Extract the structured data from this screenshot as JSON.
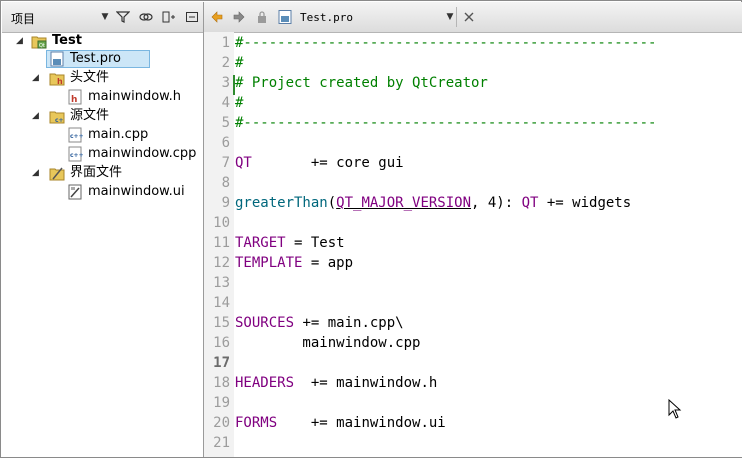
{
  "left_pane": {
    "title": "项目",
    "tree": [
      {
        "label": "Test",
        "level": 0,
        "icon": "qt-project-icon",
        "bold": true
      },
      {
        "label": "Test.pro",
        "level": 1,
        "icon": "pro-file-icon",
        "selected": true
      },
      {
        "label": "头文件",
        "level": 1,
        "icon": "header-folder-icon"
      },
      {
        "label": "mainwindow.h",
        "level": 2,
        "icon": "header-file-icon"
      },
      {
        "label": "源文件",
        "level": 1,
        "icon": "source-folder-icon"
      },
      {
        "label": "main.cpp",
        "level": 2,
        "icon": "cpp-file-icon"
      },
      {
        "label": "mainwindow.cpp",
        "level": 2,
        "icon": "cpp-file-icon"
      },
      {
        "label": "界面文件",
        "level": 1,
        "icon": "form-folder-icon"
      },
      {
        "label": "mainwindow.ui",
        "level": 2,
        "icon": "ui-file-icon"
      }
    ]
  },
  "editor": {
    "file_name": "Test.pro",
    "line_numbers": [
      "1",
      "2",
      "3",
      "4",
      "5",
      "6",
      "7",
      "8",
      "9",
      "10",
      "11",
      "12",
      "13",
      "14",
      "15",
      "16",
      "17",
      "18",
      "19",
      "20",
      "21"
    ],
    "current_line": "17",
    "lines": [
      "#-------------------------------------------------",
      "#",
      "# Project created by QtCreator",
      "#",
      "#-------------------------------------------------",
      "",
      "QT       += core gui",
      "",
      "greaterThan(QT_MAJOR_VERSION, 4): QT += widgets",
      "",
      "TARGET = Test",
      "TEMPLATE = app",
      "",
      "",
      "SOURCES += main.cpp\\",
      "        mainwindow.cpp",
      "",
      "HEADERS  += mainwindow.h",
      "",
      "FORMS    += mainwindow.ui",
      ""
    ]
  },
  "colors": {
    "comment": "#008000",
    "keyword": "#800080",
    "function": "#00677c",
    "selection": "#cce6f7"
  }
}
